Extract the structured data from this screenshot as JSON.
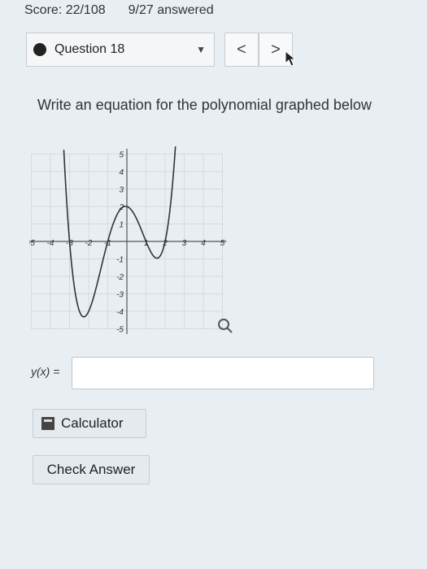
{
  "status": {
    "score": "Score: 22/108",
    "answered": "9/27 answered"
  },
  "question_nav": {
    "current": "Question 18",
    "prev_label": "<",
    "next_label": ">"
  },
  "prompt": "Write an equation for the polynomial graphed below",
  "graph": {
    "x_ticks": [
      "-5",
      "-4",
      "-3",
      "-2",
      "-1",
      "1",
      "2",
      "3",
      "4",
      "5"
    ],
    "y_ticks": [
      "5",
      "4",
      "3",
      "2",
      "1",
      "-1",
      "-2",
      "-3",
      "-4",
      "-5"
    ],
    "xlim": [
      -5,
      5
    ],
    "ylim": [
      -5,
      5
    ],
    "roots": [
      -3,
      -1,
      2
    ],
    "y_intercept": 2
  },
  "answer": {
    "label": "y(x) =",
    "value": ""
  },
  "buttons": {
    "calculator": "Calculator",
    "check": "Check Answer"
  },
  "icons": {
    "question_status": "dot-icon",
    "dropdown": "caret-down-icon",
    "zoom": "magnifier-icon",
    "calculator": "calculator-icon",
    "cursor": "pointer-cursor"
  }
}
